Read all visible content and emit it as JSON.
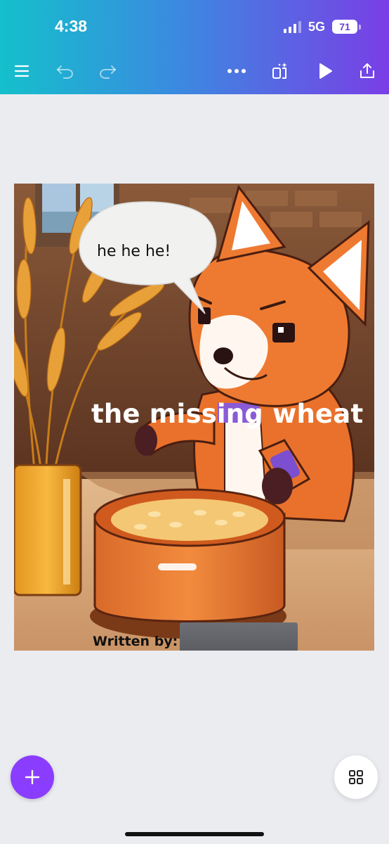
{
  "status_bar": {
    "time": "4:38",
    "network": "5G",
    "battery": "71"
  },
  "toolbar": {
    "menu_icon": "hamburger-menu-icon",
    "undo_icon": "undo-icon",
    "redo_icon": "redo-icon",
    "more_icon": "more-dots-icon",
    "resize_icon": "magic-resize-icon",
    "play_icon": "play-icon",
    "share_icon": "share-upload-icon"
  },
  "design": {
    "speech_bubble": "he he he!",
    "title": "the missing wheat",
    "byline": "Written by:"
  },
  "bottom": {
    "add_icon": "plus-icon",
    "pages_icon": "grid-icon"
  },
  "colors": {
    "accent": "#8b3dff",
    "gradient_start": "#14c0cb",
    "gradient_end": "#7a3ee6",
    "background": "#ebecf0"
  }
}
